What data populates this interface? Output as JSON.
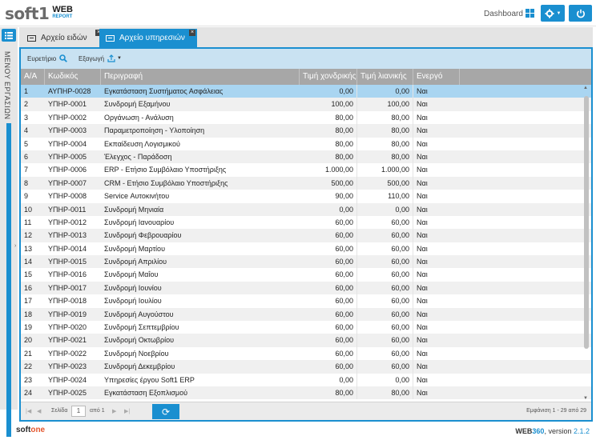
{
  "header": {
    "logo_main": "soft1",
    "logo_web": "WEB",
    "logo_report": "REPORT",
    "dashboard_label": "Dashboard"
  },
  "rail": {
    "menu_label": "ΜΕΝΟΥ ΕΡΓΑΣΙΩΝ"
  },
  "tabs": [
    {
      "label": "Αρχείο ειδών",
      "active": false
    },
    {
      "label": "Αρχείο υπηρεσιών",
      "active": true
    }
  ],
  "toolbar": {
    "search_label": "Ευρετήριο",
    "export_label": "Εξαγωγή"
  },
  "grid": {
    "columns": [
      "Α/Α",
      "Κωδικός",
      "Περιγραφή",
      "Τιμή χονδρικής",
      "Τιμή λιανικής",
      "Ενεργό"
    ],
    "rows": [
      [
        "1",
        "ΑΥΠΗΡ-0028",
        "Εγκατάσταση Συστήματος Ασφάλειας",
        "0,00",
        "0,00",
        "Ναι"
      ],
      [
        "2",
        "ΥΠΗΡ-0001",
        "Συνδρομή Εξαμήνου",
        "100,00",
        "100,00",
        "Ναι"
      ],
      [
        "3",
        "ΥΠΗΡ-0002",
        "Οργάνωση - Ανάλυση",
        "80,00",
        "80,00",
        "Ναι"
      ],
      [
        "4",
        "ΥΠΗΡ-0003",
        "Παραμετροποίηση - Υλοποίηση",
        "80,00",
        "80,00",
        "Ναι"
      ],
      [
        "5",
        "ΥΠΗΡ-0004",
        "Εκπαίδευση Λογισμικού",
        "80,00",
        "80,00",
        "Ναι"
      ],
      [
        "6",
        "ΥΠΗΡ-0005",
        "Έλεγχος - Παράδοση",
        "80,00",
        "80,00",
        "Ναι"
      ],
      [
        "7",
        "ΥΠΗΡ-0006",
        "ERP - Ετήσιο Συμβόλαιο Υποστήριξης",
        "1.000,00",
        "1.000,00",
        "Ναι"
      ],
      [
        "8",
        "ΥΠΗΡ-0007",
        "CRM - Ετήσιο Συμβόλαιο Υποστήριξης",
        "500,00",
        "500,00",
        "Ναι"
      ],
      [
        "9",
        "ΥΠΗΡ-0008",
        "Service Αυτοκινήτου",
        "90,00",
        "110,00",
        "Ναι"
      ],
      [
        "10",
        "ΥΠΗΡ-0011",
        "Συνδρομή Μηνιαία",
        "0,00",
        "0,00",
        "Ναι"
      ],
      [
        "11",
        "ΥΠΗΡ-0012",
        "Συνδρομή Ιανουαρίου",
        "60,00",
        "60,00",
        "Ναι"
      ],
      [
        "12",
        "ΥΠΗΡ-0013",
        "Συνδρομή Φεβρουαρίου",
        "60,00",
        "60,00",
        "Ναι"
      ],
      [
        "13",
        "ΥΠΗΡ-0014",
        "Συνδρομή Μαρτίου",
        "60,00",
        "60,00",
        "Ναι"
      ],
      [
        "14",
        "ΥΠΗΡ-0015",
        "Συνδρομή Απριλίου",
        "60,00",
        "60,00",
        "Ναι"
      ],
      [
        "15",
        "ΥΠΗΡ-0016",
        "Συνδρομή Μαΐου",
        "60,00",
        "60,00",
        "Ναι"
      ],
      [
        "16",
        "ΥΠΗΡ-0017",
        "Συνδρομή Ιουνίου",
        "60,00",
        "60,00",
        "Ναι"
      ],
      [
        "17",
        "ΥΠΗΡ-0018",
        "Συνδρομή Ιουλίου",
        "60,00",
        "60,00",
        "Ναι"
      ],
      [
        "18",
        "ΥΠΗΡ-0019",
        "Συνδρομή Αυγούστου",
        "60,00",
        "60,00",
        "Ναι"
      ],
      [
        "19",
        "ΥΠΗΡ-0020",
        "Συνδρομή Σεπτεμβρίου",
        "60,00",
        "60,00",
        "Ναι"
      ],
      [
        "20",
        "ΥΠΗΡ-0021",
        "Συνδρομή Οκτωβρίου",
        "60,00",
        "60,00",
        "Ναι"
      ],
      [
        "21",
        "ΥΠΗΡ-0022",
        "Συνδρομή Νοεβρίου",
        "60,00",
        "60,00",
        "Ναι"
      ],
      [
        "22",
        "ΥΠΗΡ-0023",
        "Συνδρομή Δεκεμβρίου",
        "60,00",
        "60,00",
        "Ναι"
      ],
      [
        "23",
        "ΥΠΗΡ-0024",
        "Υπηρεσίες έργου Soft1 ERP",
        "0,00",
        "0,00",
        "Ναι"
      ],
      [
        "24",
        "ΥΠΗΡ-0025",
        "Εγκατάσταση Εξοπλισμού",
        "80,00",
        "80,00",
        "Ναι"
      ]
    ],
    "selected_row": 0
  },
  "pager": {
    "page_label": "Σελίδα",
    "page_value": "1",
    "of_label": "από 1",
    "display_label": "Εμφάνιση 1 - 29 από 29"
  },
  "footer": {
    "brand_a": "soft",
    "brand_b": "one",
    "version_a": "WEB",
    "version_b": "360",
    "version_c": ", version ",
    "version_num": "2.1.2"
  },
  "colors": {
    "accent": "#1a8fd0",
    "header_gray": "#a7a7a7",
    "toolbar_bg": "#c9e2f2",
    "selected_row": "#a9d5f1"
  },
  "icons": [
    "grid-icon",
    "gear-icon",
    "power-icon",
    "list-menu-icon",
    "document-icon",
    "close-icon",
    "search-icon",
    "export-icon",
    "refresh-icon"
  ]
}
